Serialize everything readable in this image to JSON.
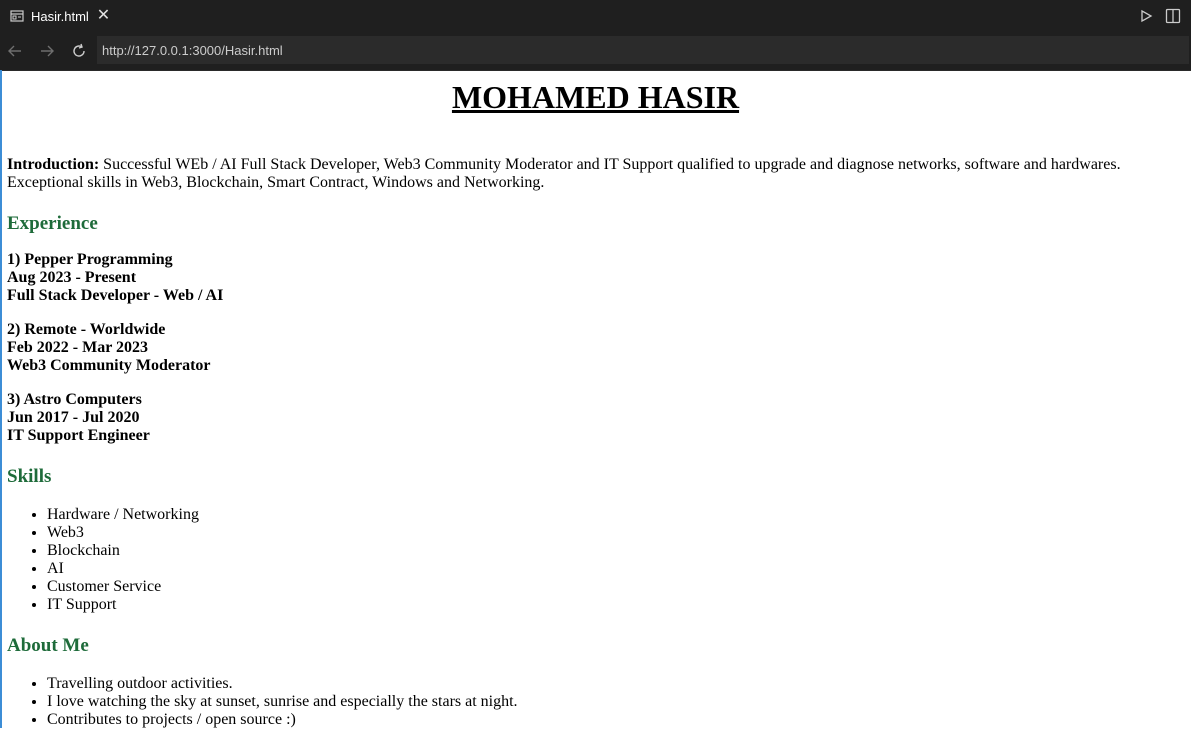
{
  "browser": {
    "tab_title": "Hasir.html",
    "url": "http://127.0.0.1:3000/Hasir.html",
    "icons": [
      "page-icon",
      "close-icon",
      "back-icon",
      "forward-icon",
      "reload-icon",
      "run-icon",
      "split-editor-icon"
    ]
  },
  "page": {
    "name": "MOHAMED HASIR",
    "intro_label": "Introduction:",
    "intro_text": " Successful WEb / AI Full Stack Developer, Web3 Community Moderator and IT Support qualified to upgrade and diagnose networks, software and hardwares. Exceptional skills in Web3, Blockchain, Smart Contract, Windows and Networking.",
    "experience_heading": "Experience",
    "experience": [
      {
        "company": "1) Pepper Programming",
        "dates": "Aug 2023 - Present",
        "role": "Full Stack Developer - Web / AI"
      },
      {
        "company": "2) Remote - Worldwide",
        "dates": "Feb 2022 - Mar 2023",
        "role": "Web3 Community Moderator"
      },
      {
        "company": "3) Astro Computers",
        "dates": "Jun 2017 - Jul 2020",
        "role": "IT Support Engineer"
      }
    ],
    "skills_heading": "Skills",
    "skills": [
      "Hardware / Networking",
      "Web3",
      "Blockchain",
      "AI",
      "Customer Service",
      "IT Support"
    ],
    "about_heading": "About Me",
    "about": [
      "Travelling outdoor activities.",
      "I love watching the sky at sunset, sunrise and especially the stars at night.",
      "Contributes to projects / open source :)"
    ]
  },
  "colors": {
    "chrome_bg": "#1f1f1f",
    "heading_green": "#1e6b3a",
    "page_border": "#3c8dd6"
  }
}
